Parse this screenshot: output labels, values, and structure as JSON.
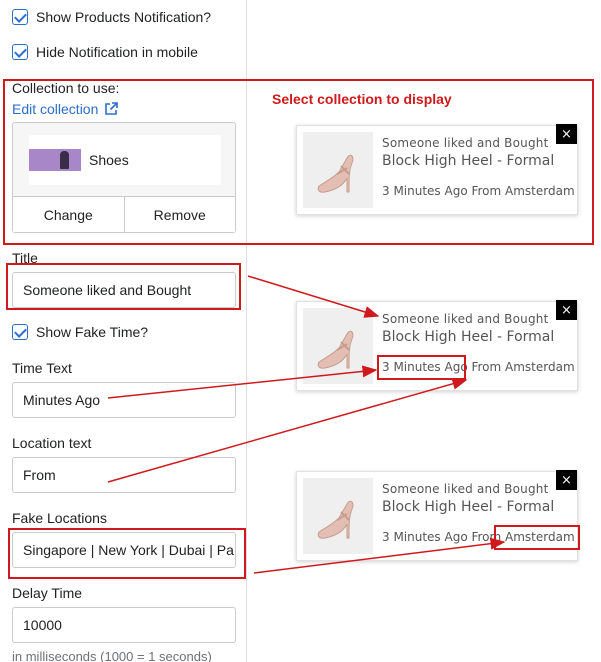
{
  "settings": {
    "show_products_notification": "Show Products Notification?",
    "hide_notification_mobile": "Hide Notification in mobile",
    "collection_label": "Collection to use:",
    "edit_collection": "Edit collection",
    "collection_name": "Shoes",
    "change_button": "Change",
    "remove_button": "Remove",
    "title_label": "Title",
    "title_value": "Someone liked and Bought",
    "show_fake_time": "Show Fake Time?",
    "time_text_label": "Time Text",
    "time_text_value": "Minutes Ago",
    "location_text_label": "Location text",
    "location_text_value": "From",
    "fake_locations_label": "Fake Locations",
    "fake_locations_value": "Singapore | New York | Dubai | Pa",
    "delay_time_label": "Delay Time",
    "delay_time_value": "10000",
    "delay_helper": "in milliseconds (1000 = 1 seconds)"
  },
  "callout": "Select collection to display",
  "notifications": [
    {
      "title": "Someone liked and Bought",
      "product": "Block High Heel - Formal",
      "meta": "3 Minutes Ago From Amsterdam",
      "close": "×"
    },
    {
      "title": "Someone liked and Bought",
      "product": "Block High Heel - Formal",
      "meta": "3 Minutes Ago From Amsterdam",
      "close": "×"
    },
    {
      "title": "Someone liked and Bought",
      "product": "Block High Heel - Formal",
      "meta": "3 Minutes Ago From Amsterdam",
      "close": "×"
    }
  ],
  "colors": {
    "accent_blue": "#2c6ecb",
    "annotation_red": "#d0191c",
    "thumbnail_purple": "#a887c9"
  }
}
